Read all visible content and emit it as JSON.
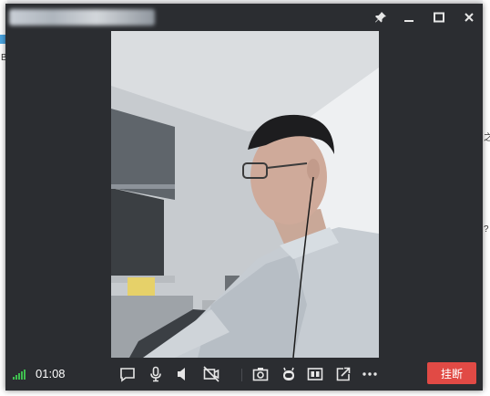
{
  "window": {
    "title": ""
  },
  "background": {
    "left_text": "B",
    "right_text_1": "之",
    "right_text_2": "?"
  },
  "call": {
    "duration": "01:08",
    "signal_level": 5,
    "hangup_label": "挂断"
  },
  "titlebar_buttons": [
    "pin-icon",
    "minimize-icon",
    "maximize-icon",
    "close-icon"
  ],
  "toolbar_icons": [
    "message-icon",
    "microphone-icon",
    "speaker-icon",
    "camera-off-icon",
    "screenshot-icon",
    "robot-icon",
    "layout-icon",
    "share-icon",
    "more-icon"
  ],
  "colors": {
    "window_bg": "#2b2d31",
    "signal": "#3fbe4f",
    "hangup": "#e14a45"
  }
}
